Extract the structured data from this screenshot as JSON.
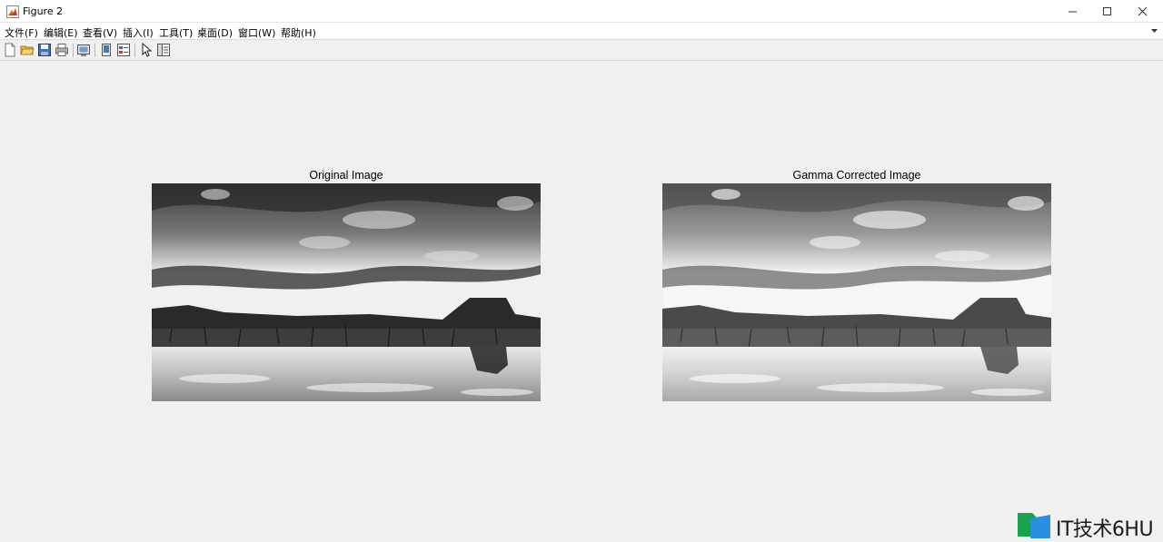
{
  "window": {
    "title": "Figure 2",
    "controls": [
      "minimize-icon",
      "maximize-icon",
      "close-icon"
    ]
  },
  "menu": [
    {
      "label": "文件(F)"
    },
    {
      "label": "编辑(E)"
    },
    {
      "label": "查看(V)"
    },
    {
      "label": "插入(I)"
    },
    {
      "label": "工具(T)"
    },
    {
      "label": "桌面(D)"
    },
    {
      "label": "窗口(W)"
    },
    {
      "label": "帮助(H)"
    }
  ],
  "toolbar": {
    "buttons": [
      "new-figure-icon",
      "open-file-icon",
      "save-icon",
      "print-icon",
      "print-preview-icon",
      "link-plot-icon",
      "insert-legend-icon",
      "edit-plot-arrow-icon",
      "property-inspector-icon"
    ]
  },
  "axes": [
    {
      "title": "Original Image"
    },
    {
      "title": "Gamma Corrected Image"
    }
  ],
  "watermark": {
    "text": "IT技术6HU"
  },
  "colors": {
    "window_bg": "#f0f0f0",
    "menubar_bg": "#ffffff",
    "watermark_green": "#1aa34a",
    "watermark_blue": "#2a8fe0"
  }
}
